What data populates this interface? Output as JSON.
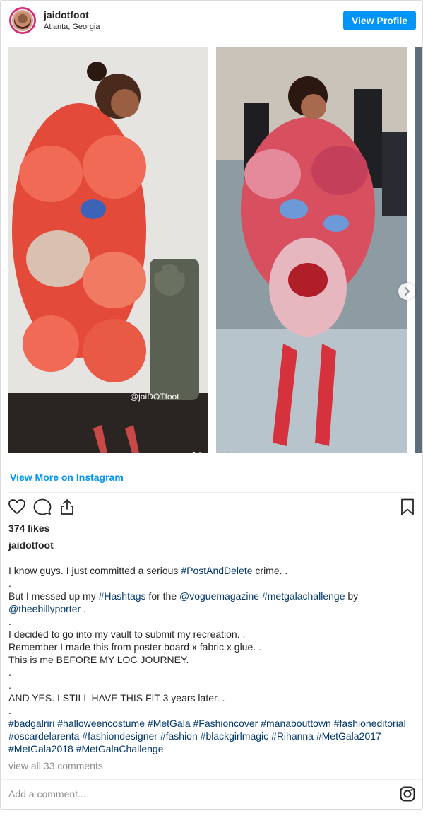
{
  "header": {
    "username": "jaidotfoot",
    "location": "Atlanta, Georgia",
    "view_profile_label": "View Profile"
  },
  "media": {
    "watermark": "@jaiDOTfoot"
  },
  "links": {
    "view_more_label": "View More on Instagram"
  },
  "actions": {
    "likes": "374 likes"
  },
  "post": {
    "username": "jaidotfoot",
    "caption": {
      "l1_a": "I know guys. I just committed a serious ",
      "l1_tag": "#PostAndDelete",
      "l1_b": " crime. .",
      "l2": ".",
      "l3_a": "But I messed up my ",
      "l3_tag1": "#Hashtags",
      "l3_b": " for the ",
      "l3_tag2": "@voguemagazine",
      "l3_c": " ",
      "l3_tag3": "#metgalachallenge",
      "l3_d": " by",
      "l4_tag": "@theebillyporter",
      "l4_b": " .",
      "l5": ".",
      "l6": "I decided to go into my vault to submit my recreation. .",
      "l7": "Remember I made this from poster board x fabric x glue. .",
      "l8": "This is me BEFORE MY LOC JOURNEY.",
      "l9": ".",
      "l10": ".",
      "l11": "AND YES. I STILL HAVE THIS FIT 3 years later. .",
      "l12": ".",
      "tags_l13": [
        "#badgalriri",
        "#halloweencostume",
        "#MetGala",
        "#Fashioncover",
        "#manabouttown",
        "#fashioneditorial"
      ],
      "tags_l14": [
        "#oscardelarenta",
        "#fashiondesigner",
        "#fashion",
        "#blackgirlmagic",
        "#Rihanna",
        "#MetGala2017"
      ],
      "tags_l15": [
        "#MetGala2018",
        "#MetGalaChallenge"
      ]
    },
    "view_comments": "view all 33 comments"
  },
  "comment": {
    "placeholder": "Add a comment..."
  },
  "icons": {
    "like": "heart-icon",
    "comment": "comment-icon",
    "share": "share-icon",
    "save": "bookmark-icon",
    "brand": "instagram-icon",
    "next": "chevron-right-icon"
  },
  "colors": {
    "accent": "#0095f6",
    "hashtag": "#00376b",
    "muted": "#8e8e8e"
  }
}
